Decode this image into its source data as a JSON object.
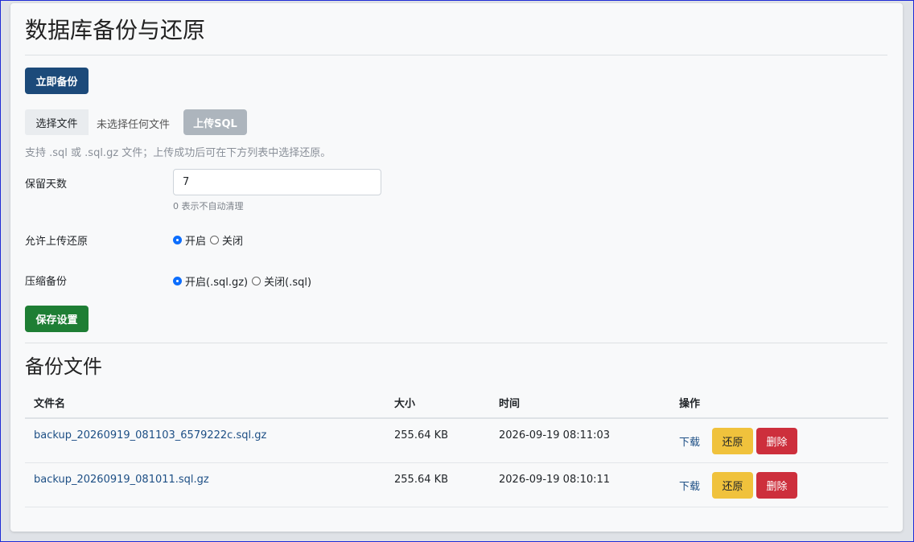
{
  "page": {
    "title": "数据库备份与还原"
  },
  "actions": {
    "backup_label": "立即备份"
  },
  "upload": {
    "choose_label": "选择文件",
    "file_status": "未选择任何文件",
    "upload_label": "上传SQL",
    "hint": "支持 .sql 或 .sql.gz 文件；上传成功后可在下方列表中选择还原。"
  },
  "settings": {
    "retention_label": "保留天数",
    "retention_value": "7",
    "retention_hint": "0 表示不自动清理",
    "allow_upload_label": "允许上传还原",
    "allow_upload_on": "开启",
    "allow_upload_off": "关闭",
    "allow_upload_selected": "on",
    "compress_label": "压缩备份",
    "compress_on": "开启(.sql.gz)",
    "compress_off": "关闭(.sql)",
    "compress_selected": "on",
    "save_label": "保存设置"
  },
  "backups": {
    "title": "备份文件",
    "columns": [
      "文件名",
      "大小",
      "时间",
      "操作"
    ],
    "rows": [
      {
        "name": "backup_20260919_081103_6579222c.sql.gz",
        "size": "255.64 KB",
        "time": "2026-09-19 08:11:03"
      },
      {
        "name": "backup_20260919_081011.sql.gz",
        "size": "255.64 KB",
        "time": "2026-09-19 08:10:11"
      }
    ],
    "download_label": "下载",
    "restore_label": "还原",
    "delete_label": "删除"
  },
  "colors": {
    "primary": "#1c4a7a",
    "success": "#1e7e34",
    "warning": "#f0c23c",
    "danger": "#cd2f3c",
    "link": "#1d4f85"
  }
}
